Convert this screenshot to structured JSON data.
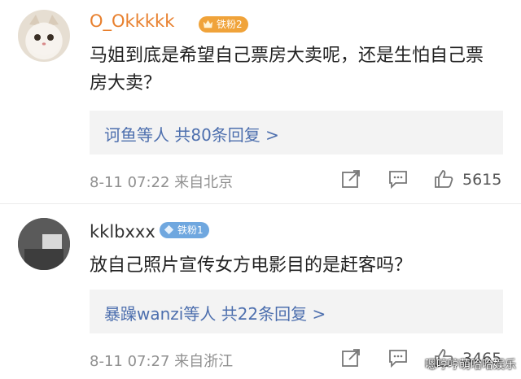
{
  "comments": [
    {
      "username": "O_Okkkkk",
      "badge": "铁粉2",
      "text": "马姐到底是希望自己票房大卖呢，还是生怕自己票房大卖？",
      "replies": "诃鱼等人 共80条回复 >",
      "meta": "8-11 07:22 来自北京",
      "likes": "5615",
      "avatar_icon": "cat-avatar",
      "badge_color": "#f0a33a"
    },
    {
      "username": "kklbxxx",
      "badge": "铁粉1",
      "text": "放自己照片宣传女方电影目的是赶客吗？",
      "replies": "暴躁wanzi等人 共22条回复 >",
      "meta": "8-11 07:27 来自浙江",
      "likes": "3465",
      "avatar_icon": "photo-avatar",
      "badge_color": "#6fa7df"
    }
  ],
  "watermark": "嗯哼哼萌哈哈娱乐"
}
